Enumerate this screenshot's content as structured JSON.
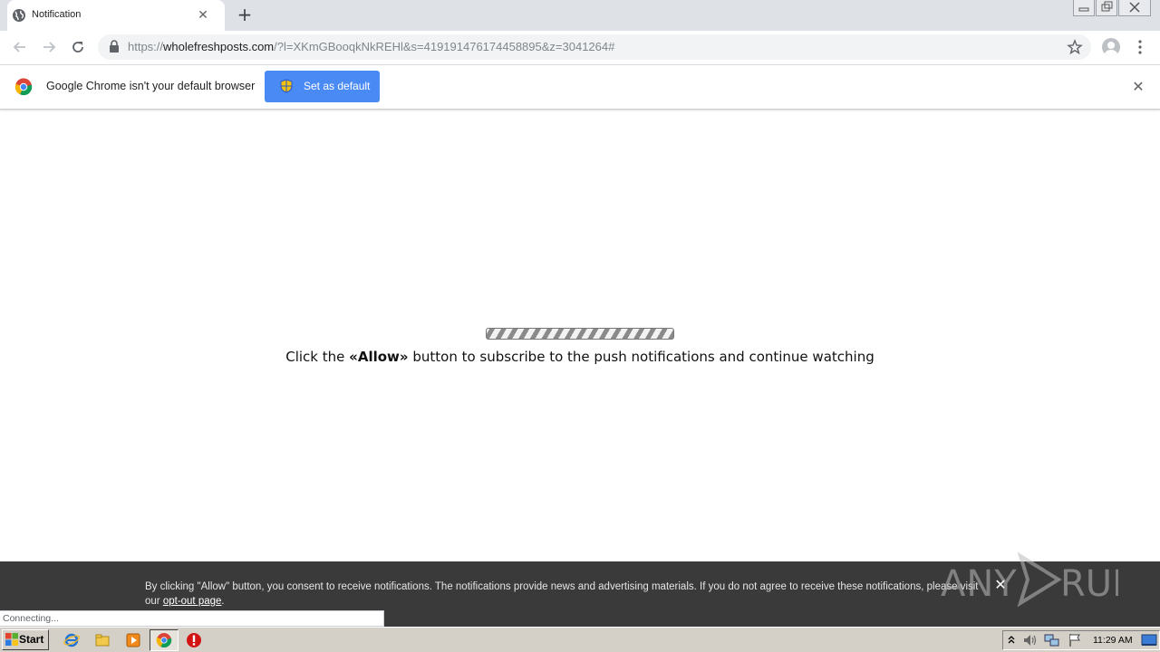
{
  "tab": {
    "title": "Notification",
    "close_glyph": "✕"
  },
  "toolbar": {
    "url_scheme": "https://",
    "url_host": "wholefreshposts.com",
    "url_rest": "/?l=XKmGBooqkNkREHl&s=419191476174458895&z=3041264#",
    "new_tab_glyph": "+"
  },
  "infobar": {
    "message": "Google Chrome isn't your default browser",
    "button_label": "Set as default",
    "close_glyph": "✕"
  },
  "page": {
    "message_before": "Click the ",
    "message_bold": "«Allow»",
    "message_after": " button to subscribe to the push notifications and continue watching"
  },
  "consent": {
    "text": "By clicking \"Allow\" button, you consent to receive notifications. The notifications provide news and advertising materials. If you do not agree to receive these notifications, please visit our ",
    "link_text": "opt-out page",
    "text_end": ".",
    "close_glyph": "✕"
  },
  "watermark": {
    "text": "ANY RUN"
  },
  "status": {
    "text": "Connecting..."
  },
  "taskbar": {
    "start_label": "Start",
    "clock": "11:29 AM",
    "icons": [
      "ie-icon",
      "explorer-icon",
      "media-player-icon",
      "chrome-icon",
      "antivirus-icon"
    ]
  },
  "colors": {
    "tabstrip": "#dee1e6",
    "accent_button": "#4a8af4",
    "consent_bar": "#3a3a3a",
    "taskbar": "#d4d0c8"
  }
}
